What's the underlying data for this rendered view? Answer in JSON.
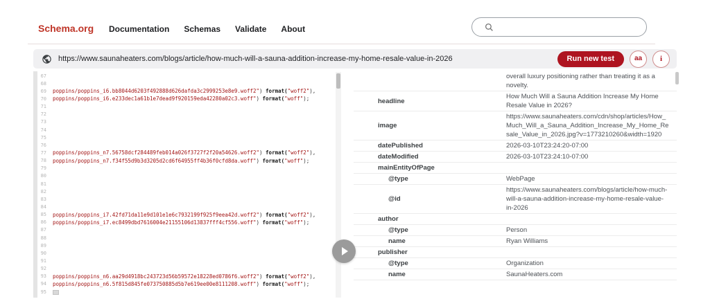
{
  "header": {
    "logo": "Schema.org",
    "nav": [
      {
        "label": "Documentation"
      },
      {
        "label": "Schemas"
      },
      {
        "label": "Validate"
      },
      {
        "label": "About"
      }
    ],
    "search": {
      "placeholder": ""
    }
  },
  "testbar": {
    "url": "https://www.saunaheaters.com/blogs/article/how-much-will-a-sauna-addition-increase-my-home-resale-value-in-2026",
    "run_button_label": "Run new test",
    "aa_icon_label": "aa",
    "info_icon_label": "i"
  },
  "colors": {
    "brand_red": "#bf3528",
    "button_red": "#ae1420",
    "code_string_red": "#a31515"
  },
  "code_panel": {
    "lines": [
      {
        "num": "67",
        "segments": []
      },
      {
        "num": "68",
        "segments": []
      },
      {
        "num": "69",
        "segments": [
          {
            "t": "str",
            "v": "poppins/poppins_i6.bb8044d6203f492888d626dafda3c2999253e8e9.woff2\""
          },
          {
            "t": "plain",
            "v": ") "
          },
          {
            "t": "kw",
            "v": "format("
          },
          {
            "t": "str",
            "v": "\"woff2\""
          },
          {
            "t": "plain",
            "v": "),"
          }
        ]
      },
      {
        "num": "70",
        "segments": [
          {
            "t": "str",
            "v": "poppins/poppins_i6.e233dec1a61b1e7dead9f920159eda42280a02c3.woff\""
          },
          {
            "t": "plain",
            "v": ") "
          },
          {
            "t": "kw",
            "v": "format("
          },
          {
            "t": "str",
            "v": "\"woff\""
          },
          {
            "t": "plain",
            "v": ");"
          }
        ]
      },
      {
        "num": "71",
        "segments": []
      },
      {
        "num": "72",
        "segments": []
      },
      {
        "num": "73",
        "segments": []
      },
      {
        "num": "74",
        "segments": []
      },
      {
        "num": "75",
        "segments": []
      },
      {
        "num": "76",
        "segments": []
      },
      {
        "num": "77",
        "segments": [
          {
            "t": "str",
            "v": "poppins/poppins_n7.56758dcf284489feb014a026f3727f2f20a54626.woff2\""
          },
          {
            "t": "plain",
            "v": ") "
          },
          {
            "t": "kw",
            "v": "format("
          },
          {
            "t": "str",
            "v": "\"woff2\""
          },
          {
            "t": "plain",
            "v": "),"
          }
        ]
      },
      {
        "num": "78",
        "segments": [
          {
            "t": "str",
            "v": "poppins/poppins_n7.f34f55d9b3d3205d2cd6f64955ff4b36f0cfd8da.woff\""
          },
          {
            "t": "plain",
            "v": ") "
          },
          {
            "t": "kw",
            "v": "format("
          },
          {
            "t": "str",
            "v": "\"woff\""
          },
          {
            "t": "plain",
            "v": ");"
          }
        ]
      },
      {
        "num": "79",
        "segments": []
      },
      {
        "num": "80",
        "segments": []
      },
      {
        "num": "81",
        "segments": []
      },
      {
        "num": "82",
        "segments": []
      },
      {
        "num": "83",
        "segments": []
      },
      {
        "num": "84",
        "segments": []
      },
      {
        "num": "85",
        "segments": [
          {
            "t": "str",
            "v": "poppins/poppins_i7.42fd71da11e9d101e1e6c7932199f925f9eea42d.woff2\""
          },
          {
            "t": "plain",
            "v": ") "
          },
          {
            "t": "kw",
            "v": "format("
          },
          {
            "t": "str",
            "v": "\"woff2\""
          },
          {
            "t": "plain",
            "v": "),"
          }
        ]
      },
      {
        "num": "86",
        "segments": [
          {
            "t": "str",
            "v": "poppins/poppins_i7.ec8499dbd7616004e21155106d13837fff4cf556.woff\""
          },
          {
            "t": "plain",
            "v": ") "
          },
          {
            "t": "kw",
            "v": "format("
          },
          {
            "t": "str",
            "v": "\"woff\""
          },
          {
            "t": "plain",
            "v": ");"
          }
        ]
      },
      {
        "num": "87",
        "segments": []
      },
      {
        "num": "88",
        "segments": []
      },
      {
        "num": "89",
        "segments": []
      },
      {
        "num": "90",
        "segments": []
      },
      {
        "num": "91",
        "segments": []
      },
      {
        "num": "92",
        "segments": []
      },
      {
        "num": "93",
        "segments": [
          {
            "t": "str",
            "v": "poppins/poppins_n6.aa29d4918bc243723d56b59572e18228ed0786f6.woff2\""
          },
          {
            "t": "plain",
            "v": ") "
          },
          {
            "t": "kw",
            "v": "format("
          },
          {
            "t": "str",
            "v": "\"woff2\""
          },
          {
            "t": "plain",
            "v": "),"
          }
        ]
      },
      {
        "num": "94",
        "segments": [
          {
            "t": "str",
            "v": "poppins/poppins_n6.5f815d845fe073750885d5b7e619ee00e8111208.woff\""
          },
          {
            "t": "plain",
            "v": ") "
          },
          {
            "t": "kw",
            "v": "format("
          },
          {
            "t": "str",
            "v": "\"woff\""
          },
          {
            "t": "plain",
            "v": ");"
          }
        ]
      },
      {
        "num": "95",
        "segments": [
          {
            "t": "box",
            "v": ""
          }
        ]
      }
    ]
  },
  "results_table": {
    "rows": [
      {
        "level": 0,
        "property": "",
        "value": "overall luxury positioning rather than treating it as a novelty."
      },
      {
        "level": 0,
        "property": "headline",
        "value": "How Much Will a Sauna Addition Increase My Home Resale Value in 2026?"
      },
      {
        "level": 0,
        "property": "image",
        "value": "https://www.saunaheaters.com/cdn/shop/articles/How_Much_Will_a_Sauna_Addition_Increase_My_Home_Resale_Value_in_2026.jpg?v=1773210260&width=1920"
      },
      {
        "level": 0,
        "property": "datePublished",
        "value": "2026-03-10T23:24:20-07:00"
      },
      {
        "level": 0,
        "property": "dateModified",
        "value": "2026-03-10T23:24:10-07:00"
      },
      {
        "level": 0,
        "property": "mainEntityOfPage",
        "value": ""
      },
      {
        "level": 1,
        "property": "@type",
        "value": "WebPage"
      },
      {
        "level": 1,
        "property": "@id",
        "value": "https://www.saunaheaters.com/blogs/article/how-much-will-a-sauna-addition-increase-my-home-resale-value-in-2026"
      },
      {
        "level": 0,
        "property": "author",
        "value": ""
      },
      {
        "level": 1,
        "property": "@type",
        "value": "Person"
      },
      {
        "level": 1,
        "property": "name",
        "value": "Ryan Williams"
      },
      {
        "level": 0,
        "property": "publisher",
        "value": ""
      },
      {
        "level": 1,
        "property": "@type",
        "value": "Organization"
      },
      {
        "level": 1,
        "property": "name",
        "value": "SaunaHeaters.com"
      }
    ]
  }
}
